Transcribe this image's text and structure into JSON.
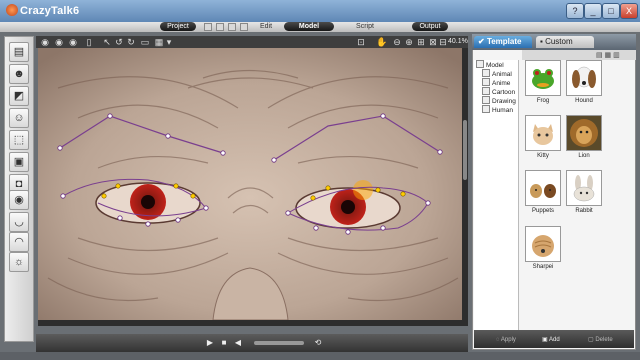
{
  "app": {
    "title": "CrazyTalk6"
  },
  "window_controls": {
    "minimize": "_",
    "maximize": "□",
    "close": "X",
    "help": "?"
  },
  "menu": {
    "tabs": [
      "Project",
      "Edit",
      "Model",
      "Script",
      "Output"
    ],
    "active": "Model"
  },
  "viewport": {
    "zoom": "40.1%"
  },
  "right_panel": {
    "tabs": {
      "template": "Template",
      "custom": "Custom"
    },
    "tree": {
      "root": "Model",
      "items": [
        "Animal",
        "Anime",
        "Cartoon",
        "Drawing",
        "Human"
      ]
    },
    "thumbnails": [
      "Frog",
      "Hound",
      "Kitty",
      "Lion",
      "Puppets",
      "Rabbit",
      "Sharpei"
    ],
    "footer": {
      "apply": "Apply",
      "add": "Add",
      "delete": "Delete"
    }
  },
  "colors": {
    "accent": "#2b6fb1",
    "landmark_point": "#ffffff",
    "corner_point": "#ffcc00",
    "contour_line": "#7a3f8f"
  }
}
